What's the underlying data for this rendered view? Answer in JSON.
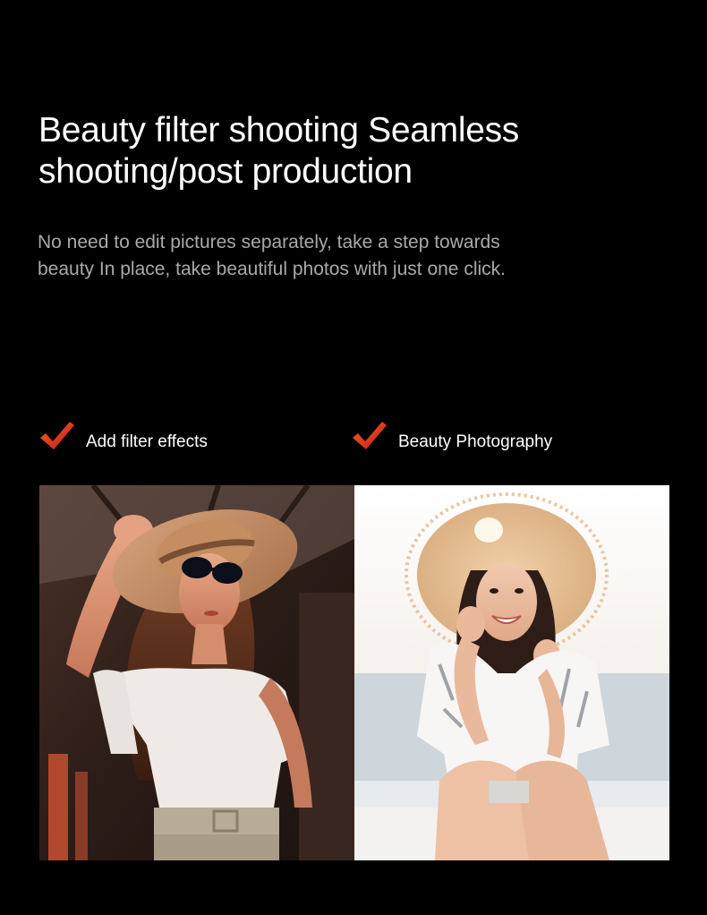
{
  "headline": {
    "line1": "Beauty filter shooting Seamless",
    "line2": "shooting/post production"
  },
  "description": {
    "line1": "No need to edit pictures separately, take a step towards",
    "line2": "beauty In place, take beautiful photos with just one click."
  },
  "features": [
    {
      "label": "Add filter effects",
      "icon": "checkmark-icon"
    },
    {
      "label": "Beauty Photography",
      "icon": "checkmark-icon"
    }
  ],
  "photos": [
    {
      "subject": "woman in straw hat and sunglasses, warm filter",
      "icon": "photo"
    },
    {
      "subject": "smiling woman with straw hat on beach",
      "icon": "photo"
    }
  ],
  "colors": {
    "background": "#000000",
    "headline": "#ffffff",
    "description": "#a9a9a9",
    "checkmark_top": "#f04a1a",
    "checkmark_bottom": "#c4161c"
  }
}
